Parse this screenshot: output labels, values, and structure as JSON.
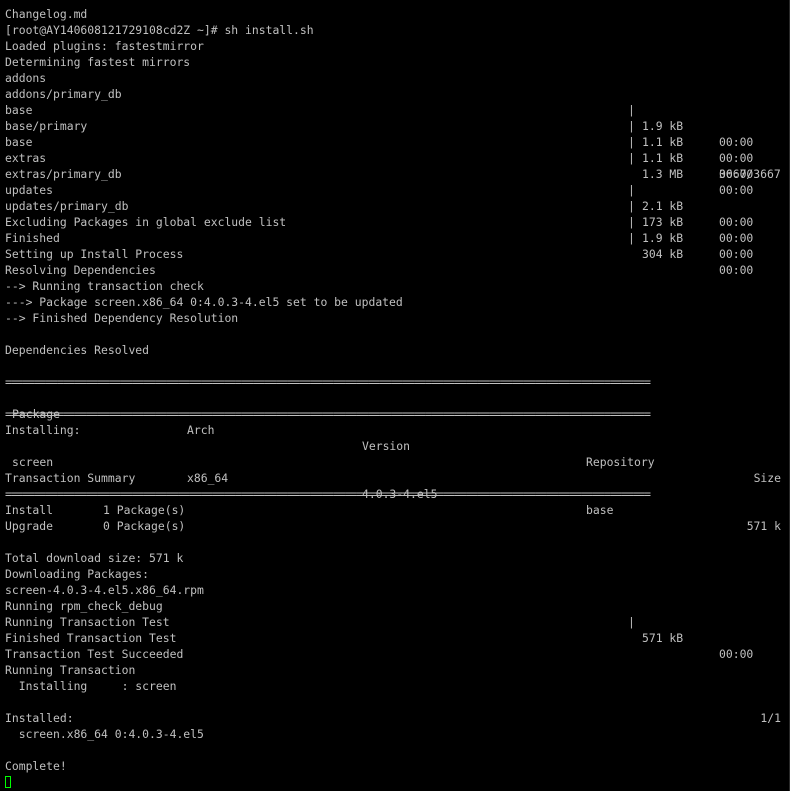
{
  "accent": "#00ff00",
  "text_color": "#c0c0c0",
  "background": "#000000",
  "lines_top": [
    "Changelog.md",
    "[root@AY140608121729108cd2Z ~]# sh install.sh",
    "Loaded plugins: fastestmirror",
    "Determining fastest mirrors"
  ],
  "repos": [
    {
      "name": "addons",
      "size": "1.9 kB",
      "time": "00:00"
    },
    {
      "name": "addons/primary_db",
      "size": "1.1 kB",
      "time": "00:00"
    },
    {
      "name": "base",
      "size": "1.1 kB",
      "time": "00:00"
    },
    {
      "name": "base/primary",
      "size": "1.3 MB",
      "time": "00:00"
    }
  ],
  "base_progress": {
    "name": "base",
    "progress": "3667/3667"
  },
  "repos2": [
    {
      "name": "extras",
      "size": "2.1 kB",
      "time": "00:00"
    },
    {
      "name": "extras/primary_db",
      "size": "173 kB",
      "time": "00:00"
    },
    {
      "name": "updates",
      "size": "1.9 kB",
      "time": "00:00"
    },
    {
      "name": "updates/primary_db",
      "size": "304 kB",
      "time": "00:00"
    }
  ],
  "lines_mid": [
    "Excluding Packages in global exclude list",
    "Finished",
    "Setting up Install Process",
    "Resolving Dependencies",
    "--> Running transaction check",
    "---> Package screen.x86_64 0:4.0.3-4.el5 set to be updated",
    "--> Finished Dependency Resolution",
    "",
    "Dependencies Resolved",
    ""
  ],
  "separator": "================================================================================================================",
  "table": {
    "headers": {
      "package": "Package",
      "arch": "Arch",
      "version": "Version",
      "repository": "Repository",
      "size": "Size"
    },
    "installing_label": "Installing:",
    "row": {
      "package": "screen",
      "arch": "x86_64",
      "version": "4.0.3-4.el5",
      "repository": "base",
      "size": "571 k"
    }
  },
  "transaction_summary": "Transaction Summary",
  "summary": [
    {
      "label": "Install",
      "value": "1 Package(s)"
    },
    {
      "label": "Upgrade",
      "value": "0 Package(s)"
    }
  ],
  "total_download": "Total download size: 571 k",
  "downloading": "Downloading Packages:",
  "rpm": {
    "name": "screen-4.0.3-4.el5.x86_64.rpm",
    "size": "571 kB",
    "time": "00:00"
  },
  "lines_tx": [
    "Running rpm_check_debug",
    "Running Transaction Test",
    "Finished Transaction Test",
    "Transaction Test Succeeded",
    "Running Transaction"
  ],
  "installing_line": {
    "text": "  Installing     : screen",
    "count": "1/1"
  },
  "installed_label": "Installed:",
  "installed_pkg": "  screen.x86_64 0:4.0.3-4.el5",
  "complete": "Complete!"
}
